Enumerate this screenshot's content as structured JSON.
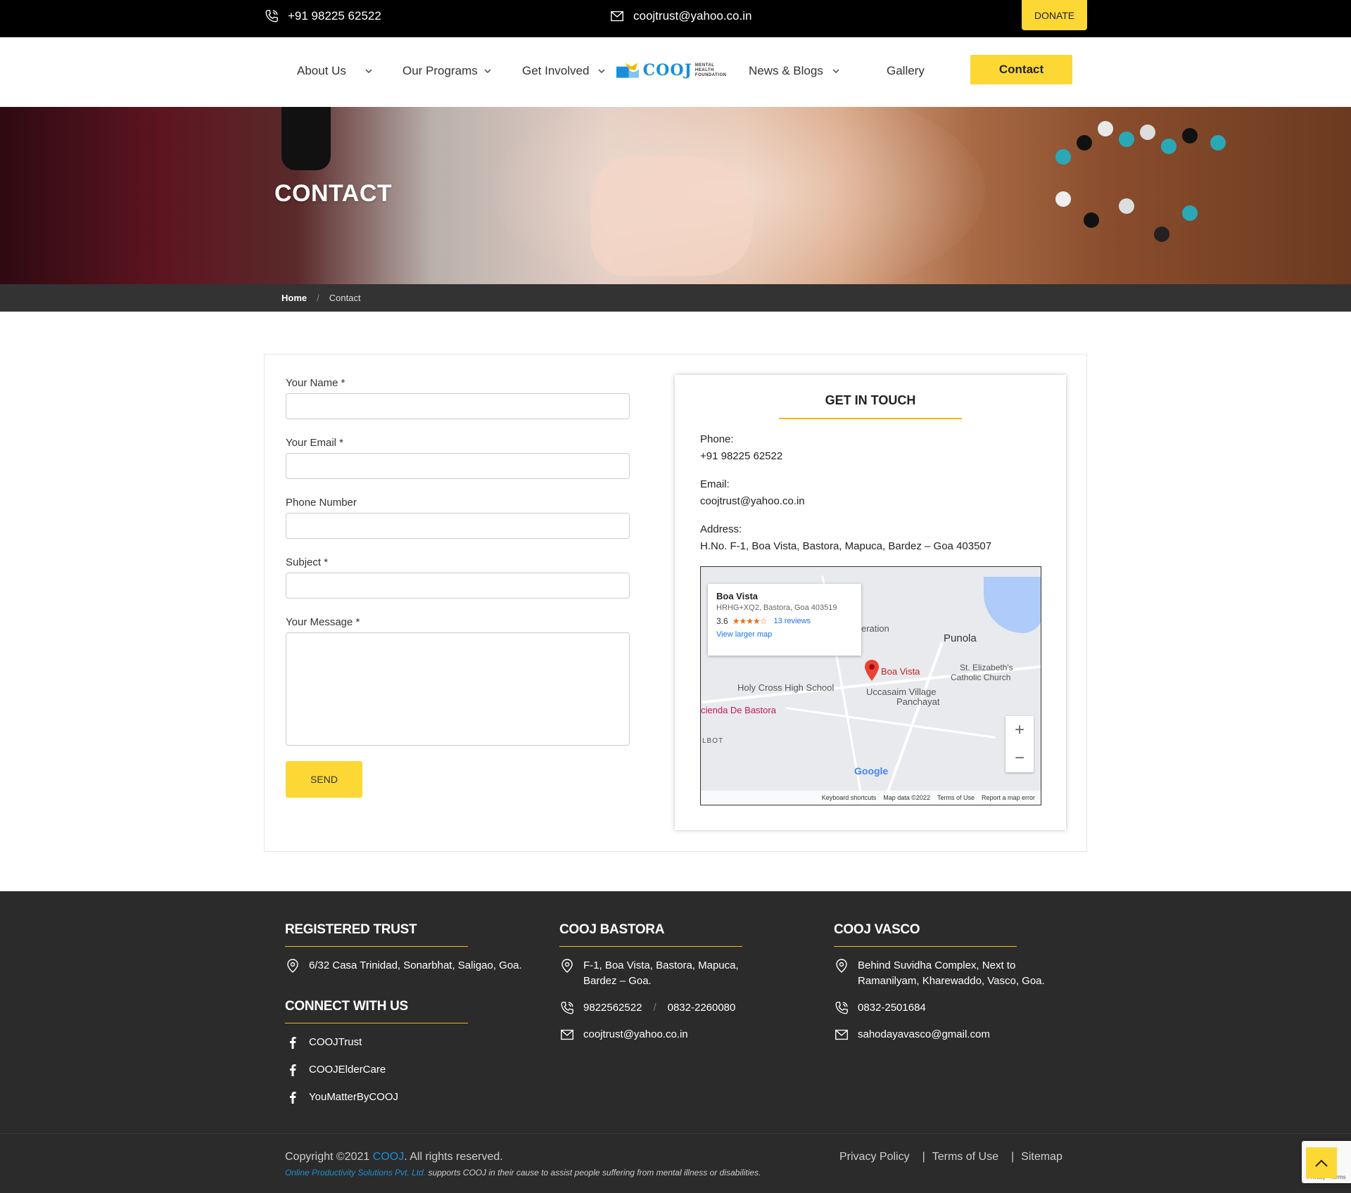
{
  "topbar": {
    "phone": "+91 98225 62522",
    "email": "coojtrust@yahoo.co.in",
    "donate": "DONATE"
  },
  "nav": {
    "items": [
      "About Us",
      "Our Programs",
      "Get Involved",
      "News & Blogs",
      "Gallery"
    ],
    "logo_word": "COOJ",
    "logo_sub1": "MENTAL HEALTH",
    "logo_sub2": "FOUNDATION",
    "contact": "Contact"
  },
  "hero": {
    "title": "CONTACT"
  },
  "breadcrumb": {
    "home": "Home",
    "sep": "/",
    "current": "Contact"
  },
  "form": {
    "name_label": "Your Name *",
    "email_label": "Your Email *",
    "phone_label": "Phone Number",
    "subject_label": "Subject *",
    "message_label": "Your Message *",
    "send": "SEND"
  },
  "get_in_touch": {
    "title": "GET IN TOUCH",
    "phone_label": "Phone:",
    "phone": "+91 98225 62522",
    "email_label": "Email:",
    "email": "coojtrust@yahoo.co.in",
    "address_label": "Address:",
    "address": "H.No. F-1, Boa Vista, Bastora, Mapuca, Bardez – Goa 403507"
  },
  "map": {
    "place": "Boa Vista",
    "place_address": "HRHG+XQ2, Bastora, Goa 403519",
    "rating": "3.6",
    "stars": "★★★★☆",
    "reviews": "13 reviews",
    "view_larger": "View larger map",
    "labels": {
      "punola": "Punola",
      "boa_vista": "Boa Vista",
      "eration": "eration",
      "st_eliz": "St. Elizabeth's",
      "catholic": "Catholic Church",
      "holy_cross": "Holy Cross High School",
      "uccasaim": "Uccasaim Village",
      "panchayat": "Panchayat",
      "hacienda": "cienda De Bastora",
      "albot": "LBOT"
    },
    "google": "Google",
    "footer": [
      "Keyboard shortcuts",
      "Map data ©2022",
      "Terms of Use",
      "Report a map error"
    ]
  },
  "footer": {
    "registered": {
      "title": "REGISTERED TRUST",
      "address": "6/32 Casa Trinidad, Sonarbhat, Saligao, Goa."
    },
    "connect": {
      "title": "CONNECT WITH US",
      "links": [
        "COOJTrust",
        "COOJElderCare",
        "YouMatterByCOOJ"
      ]
    },
    "bastora": {
      "title": "COOJ BASTORA",
      "address1": "F-1, Boa Vista, Bastora, Mapuca,",
      "address2": "Bardez – Goa.",
      "phone1": "9822562522",
      "phone_sep": "/",
      "phone2": "0832-2260080",
      "email": "coojtrust@yahoo.co.in"
    },
    "vasco": {
      "title": "COOJ VASCO",
      "address1": "Behind Suvidha Complex, Next to",
      "address2": "Ramanilyam, Kharewaddo, Vasco, Goa.",
      "phone": "0832-2501684",
      "email": "sahodayavasco@gmail.com"
    }
  },
  "bottom": {
    "copy_pre": "Copyright ©2021 ",
    "copy_brand": "COOJ",
    "copy_post": ". All rights reserved.",
    "ops": "Online Productivity Solutions Pvt. Ltd.",
    "supports": " supports COOJ in their cause to assist people suffering from mental illness or disabilities.",
    "links": [
      "Privacy Policy",
      "Terms of Use",
      "Sitemap"
    ],
    "link_sep": "|",
    "recaptcha": "Privacy - Terms"
  },
  "colors": {
    "accent": "#fdd835",
    "brand_blue": "#1a8fd8",
    "dark": "#2b2b2b"
  }
}
